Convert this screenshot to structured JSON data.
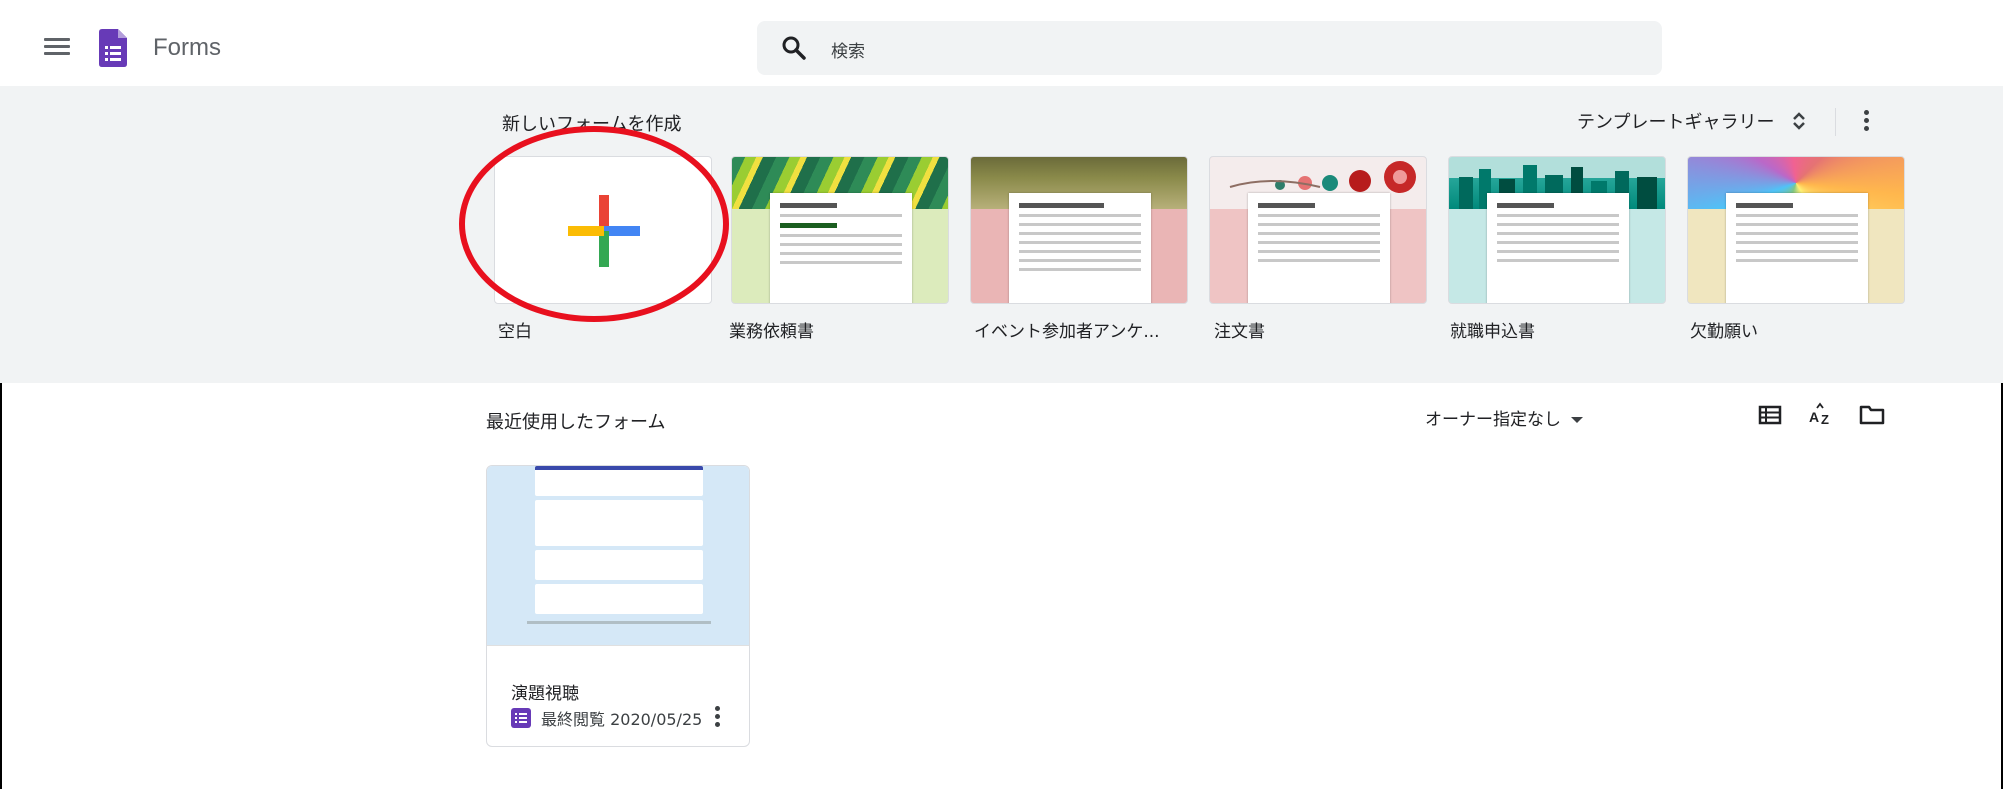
{
  "header": {
    "app_title": "Forms",
    "search_placeholder": "検索"
  },
  "templates": {
    "section_title": "新しいフォームを作成",
    "gallery_label": "テンプレートギャラリー",
    "items": [
      {
        "label": "空白"
      },
      {
        "label": "業務依頼書"
      },
      {
        "label": "イベント参加者アンケ..."
      },
      {
        "label": "注文書"
      },
      {
        "label": "就職申込書"
      },
      {
        "label": "欠勤願い"
      }
    ]
  },
  "recent": {
    "section_title": "最近使用したフォーム",
    "owner_filter": "オーナー指定なし",
    "docs": [
      {
        "name": "演題視聴",
        "meta": "最終閲覧 2020/05/25"
      }
    ]
  },
  "colors": {
    "forms_purple": "#673ab7",
    "annotation_red": "#e8101e",
    "section_bg": "#f1f3f4"
  },
  "icons": [
    "menu-icon",
    "forms-logo-icon",
    "search-icon",
    "unfold-icon",
    "more-vert-icon",
    "list-view-icon",
    "sort-az-icon",
    "folder-icon"
  ]
}
